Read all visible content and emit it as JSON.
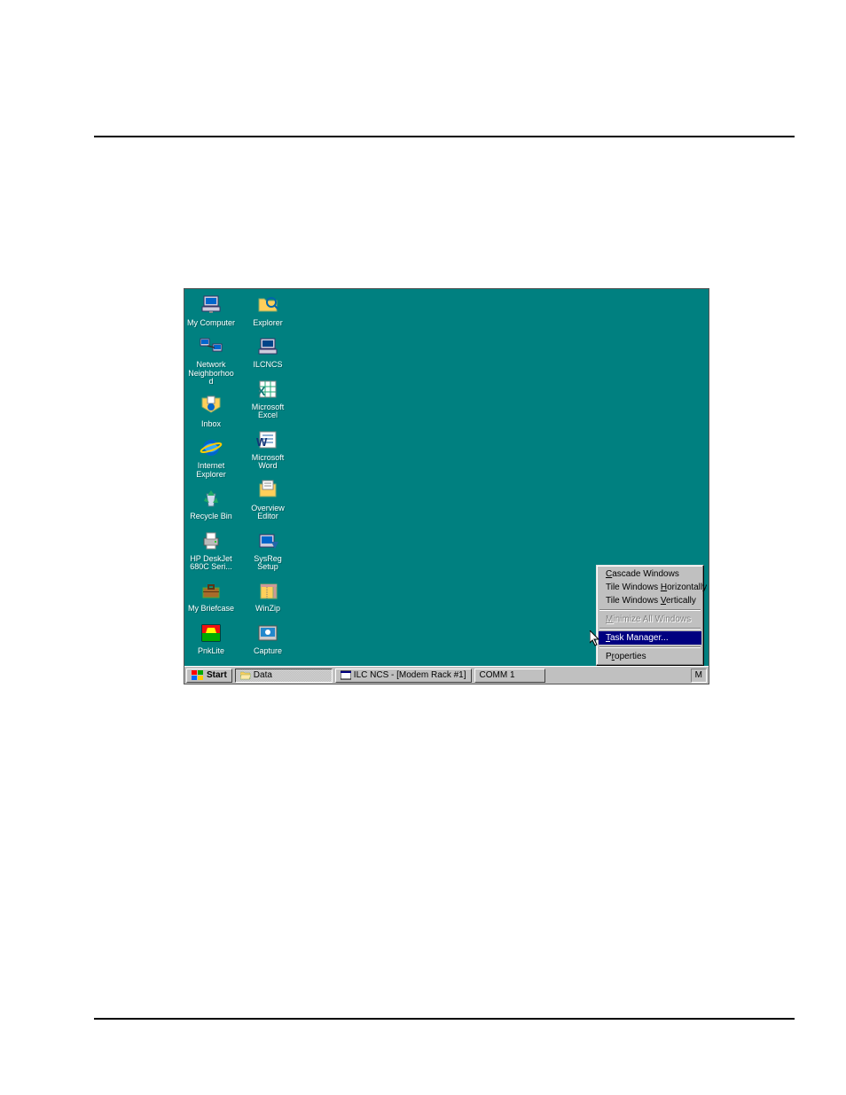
{
  "desktop": {
    "icons_col1": [
      {
        "label": "My Computer",
        "icon": "computer"
      },
      {
        "label": "Network Neighborhood",
        "icon": "network"
      },
      {
        "label": "Inbox",
        "icon": "inbox"
      },
      {
        "label": "Internet Explorer",
        "icon": "ie"
      },
      {
        "label": "Recycle Bin",
        "icon": "recycle"
      },
      {
        "label": "HP DeskJet 680C Seri...",
        "icon": "printer"
      },
      {
        "label": "My Briefcase",
        "icon": "briefcase"
      },
      {
        "label": "PnkLite",
        "icon": "pnklite"
      }
    ],
    "icons_col2": [
      {
        "label": "Explorer",
        "icon": "explorer"
      },
      {
        "label": "ILCNCS",
        "icon": "ilcncs"
      },
      {
        "label": "Microsoft Excel",
        "icon": "excel"
      },
      {
        "label": "Microsoft Word",
        "icon": "word"
      },
      {
        "label": "Overview Editor",
        "icon": "overview"
      },
      {
        "label": "SysReg Setup",
        "icon": "sysreg"
      },
      {
        "label": "WinZip",
        "icon": "winzip"
      },
      {
        "label": "Capture",
        "icon": "capture"
      }
    ]
  },
  "taskbar": {
    "start": "Start",
    "task1": "Data",
    "task2": "ILC NCS - [Modem Rack #1]",
    "task3": "COMM 1",
    "tray": "M"
  },
  "context_menu": {
    "items": [
      {
        "label": "Cascade Windows",
        "enabled": true,
        "highlight": false,
        "u": 0
      },
      {
        "label": "Tile Windows Horizontally",
        "enabled": true,
        "highlight": false,
        "u": 13
      },
      {
        "label": "Tile Windows Vertically",
        "enabled": true,
        "highlight": false,
        "u": 13
      },
      {
        "sep": true
      },
      {
        "label": "Minimize All Windows",
        "enabled": false,
        "highlight": false,
        "u": 0
      },
      {
        "sep": true
      },
      {
        "label": "Task Manager...",
        "enabled": true,
        "highlight": true,
        "u": 0
      },
      {
        "sep": true
      },
      {
        "label": "Properties",
        "enabled": true,
        "highlight": false,
        "u": 1
      }
    ]
  }
}
